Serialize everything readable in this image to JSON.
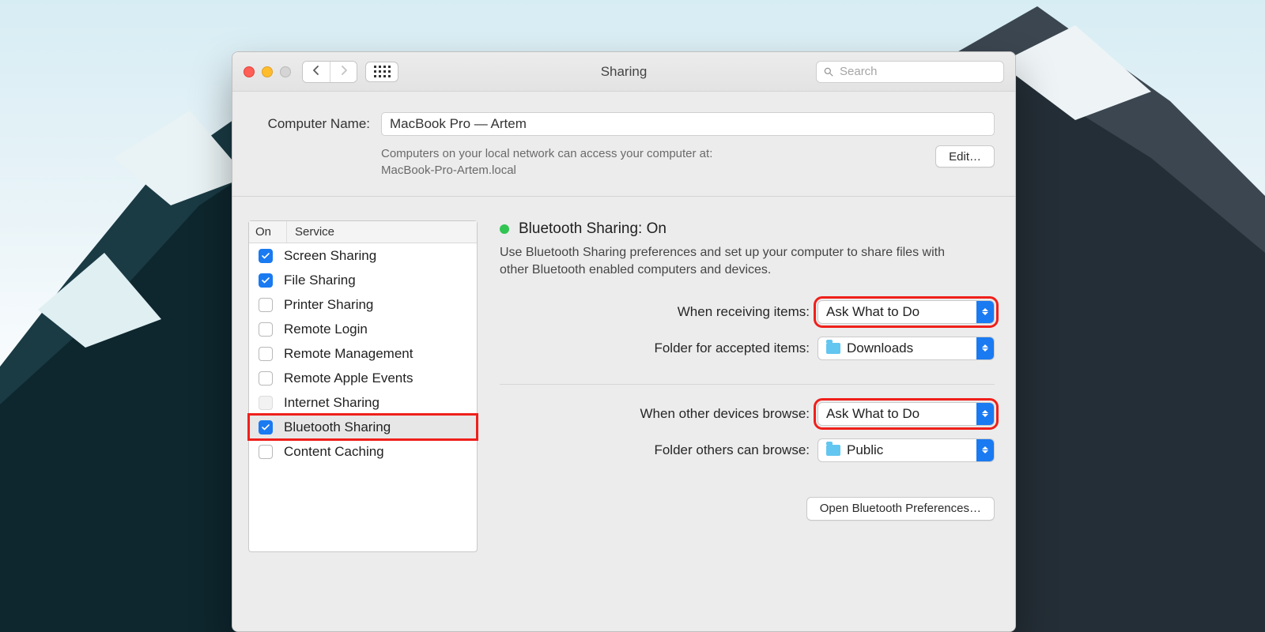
{
  "window": {
    "title": "Sharing",
    "search_placeholder": "Search"
  },
  "top": {
    "computer_name_label": "Computer Name:",
    "computer_name_value": "MacBook Pro — Artem",
    "note_line1": "Computers on your local network can access your computer at:",
    "note_line2": "MacBook-Pro-Artem.local",
    "edit_button": "Edit…"
  },
  "services": {
    "col_on": "On",
    "col_service": "Service",
    "items": [
      {
        "label": "Screen Sharing",
        "checked": true,
        "disabled": false,
        "selected": false
      },
      {
        "label": "File Sharing",
        "checked": true,
        "disabled": false,
        "selected": false
      },
      {
        "label": "Printer Sharing",
        "checked": false,
        "disabled": false,
        "selected": false
      },
      {
        "label": "Remote Login",
        "checked": false,
        "disabled": false,
        "selected": false
      },
      {
        "label": "Remote Management",
        "checked": false,
        "disabled": false,
        "selected": false
      },
      {
        "label": "Remote Apple Events",
        "checked": false,
        "disabled": false,
        "selected": false
      },
      {
        "label": "Internet Sharing",
        "checked": false,
        "disabled": true,
        "selected": false
      },
      {
        "label": "Bluetooth Sharing",
        "checked": true,
        "disabled": false,
        "selected": true
      },
      {
        "label": "Content Caching",
        "checked": false,
        "disabled": false,
        "selected": false
      }
    ]
  },
  "pane": {
    "status_title": "Bluetooth Sharing: On",
    "description": "Use Bluetooth Sharing preferences and set up your computer to share files with other Bluetooth enabled computers and devices.",
    "when_receiving_label": "When receiving items:",
    "when_receiving_value": "Ask What to Do",
    "accepted_folder_label": "Folder for accepted items:",
    "accepted_folder_value": "Downloads",
    "when_browse_label": "When other devices browse:",
    "when_browse_value": "Ask What to Do",
    "browse_folder_label": "Folder others can browse:",
    "browse_folder_value": "Public",
    "open_bt_prefs": "Open Bluetooth Preferences…"
  }
}
